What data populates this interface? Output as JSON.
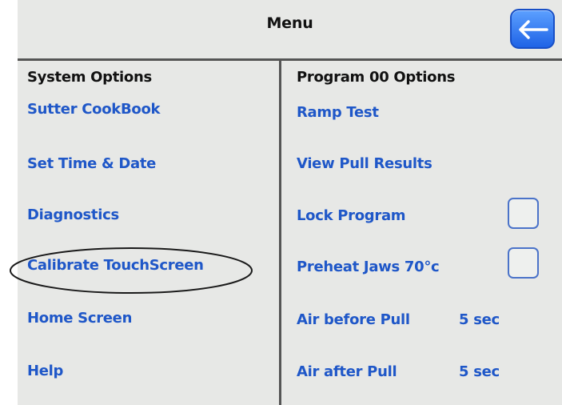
{
  "header": {
    "title": "Menu",
    "back_icon": "arrow-left-icon",
    "back_button_color": "#2f74f0"
  },
  "system_options": {
    "heading": "System Options",
    "items": [
      {
        "label": "Sutter CookBook"
      },
      {
        "label": "Set Time & Date"
      },
      {
        "label": "Diagnostics"
      },
      {
        "label": "Calibrate TouchScreen"
      },
      {
        "label": "Home Screen"
      },
      {
        "label": "Help"
      }
    ]
  },
  "program_options": {
    "heading": "Program 00 Options",
    "items": [
      {
        "label": "Ramp Test"
      },
      {
        "label": "View Pull Results"
      },
      {
        "label": "Lock Program",
        "checked": false
      },
      {
        "label": "Preheat Jaws 70°c",
        "checked": false
      },
      {
        "label": "Air before Pull",
        "value": "5 sec"
      },
      {
        "label": "Air after Pull",
        "value": "5 sec"
      }
    ]
  },
  "colors": {
    "background": "#e7e8e6",
    "item_text": "#1f57c8",
    "heading_text": "#111111",
    "divider": "#555555"
  }
}
